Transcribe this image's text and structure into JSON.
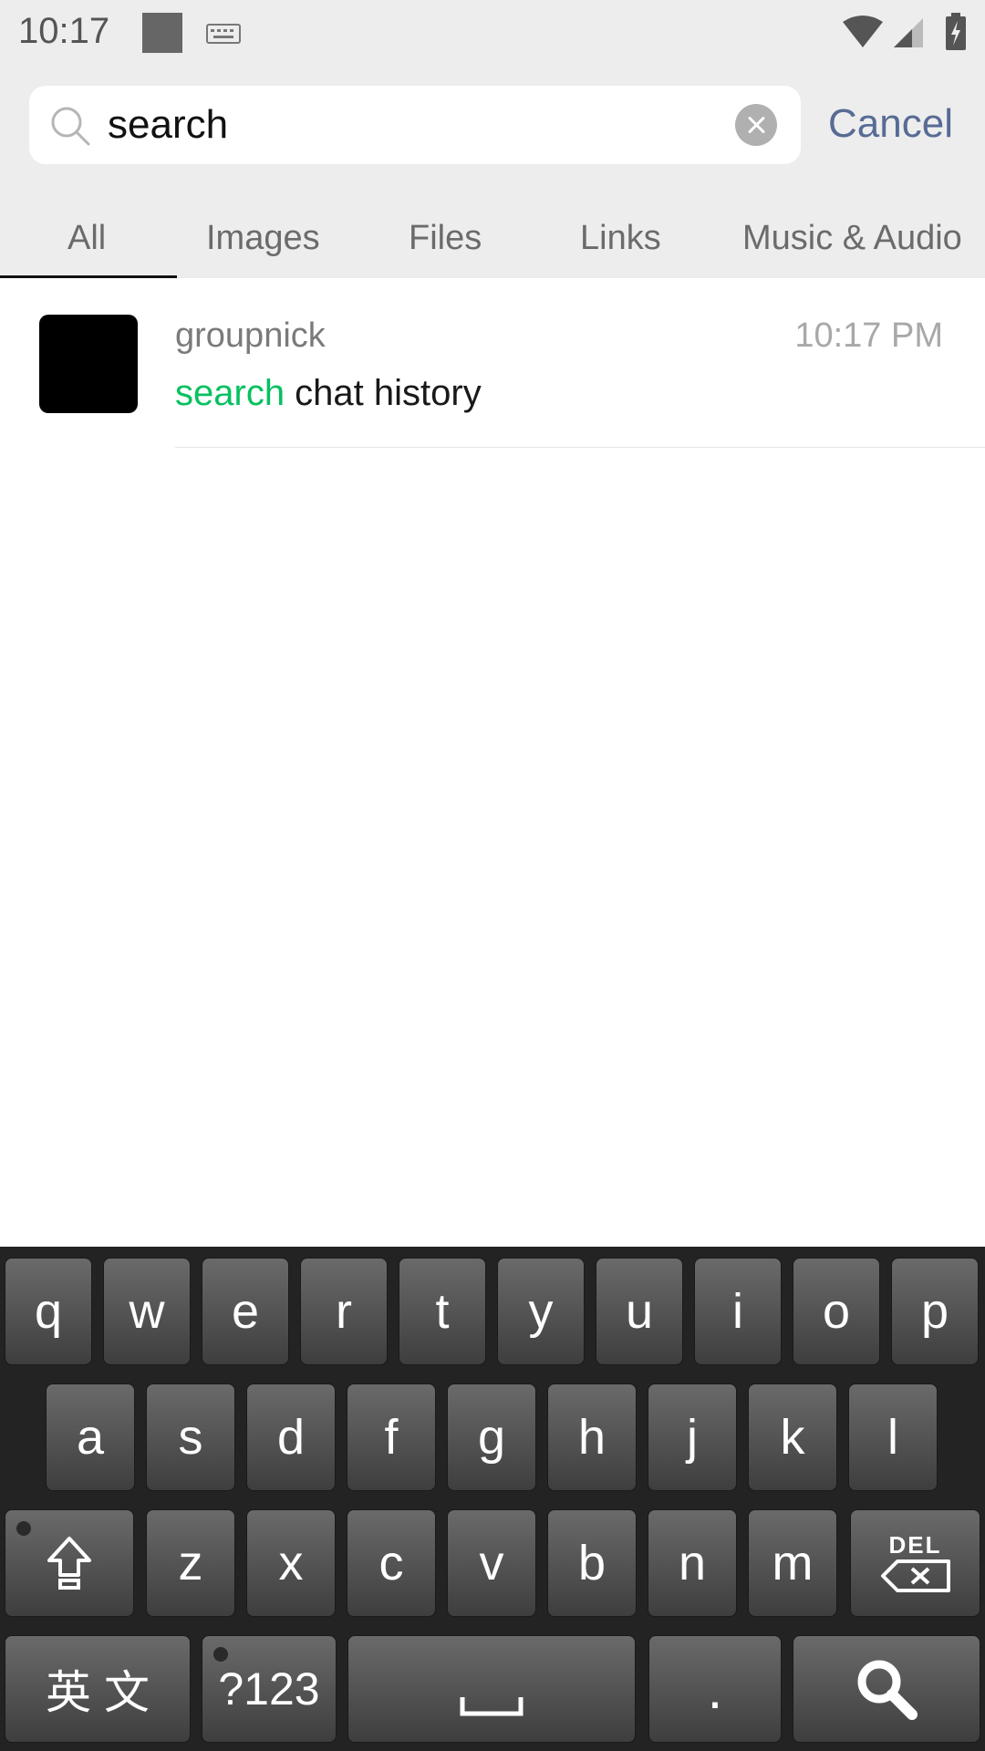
{
  "status_bar": {
    "time": "10:17"
  },
  "search": {
    "value": "search",
    "cancel_label": "Cancel"
  },
  "tabs": [
    {
      "label": "All",
      "active": true
    },
    {
      "label": "Images"
    },
    {
      "label": "Files"
    },
    {
      "label": "Links"
    },
    {
      "label": "Music & Audio"
    }
  ],
  "results": [
    {
      "name": "groupnick",
      "time": "10:17 PM",
      "match": "search",
      "rest": " chat history"
    }
  ],
  "keyboard": {
    "row1": [
      "q",
      "w",
      "e",
      "r",
      "t",
      "y",
      "u",
      "i",
      "o",
      "p"
    ],
    "row2": [
      "a",
      "s",
      "d",
      "f",
      "g",
      "h",
      "j",
      "k",
      "l"
    ],
    "row3": [
      "z",
      "x",
      "c",
      "v",
      "b",
      "n",
      "m"
    ],
    "lang_label": "英 文",
    "symbols_label": "?123",
    "del_label": "DEL",
    "period_label": "."
  },
  "colors": {
    "accent_green": "#07c160",
    "link_blue": "#576b95"
  },
  "icons": [
    "search-icon",
    "clear-icon",
    "wifi-icon",
    "signal-icon",
    "battery-icon",
    "keyboard-icon",
    "shift-icon",
    "backspace-icon",
    "space-icon",
    "search-key-icon"
  ]
}
